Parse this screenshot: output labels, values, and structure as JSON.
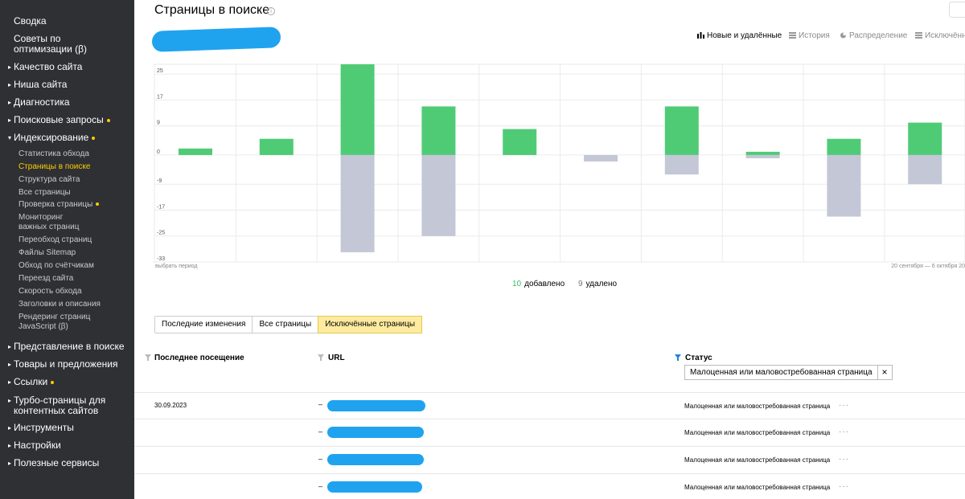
{
  "sidebar": {
    "top_items": [
      {
        "label": "Сводка"
      },
      {
        "label": "Советы по",
        "label2": "оптимизации (β)"
      }
    ],
    "sections": [
      {
        "label": "Качество сайта",
        "dot": false
      },
      {
        "label": "Ниша сайта",
        "dot": false
      },
      {
        "label": "Диагностика",
        "dot": false
      },
      {
        "label": "Поисковые запросы",
        "dot": true
      },
      {
        "label": "Индексирование",
        "dot": true
      }
    ],
    "indexing_items": [
      "Статистика обхода",
      "Страницы в поиске",
      "Структура сайта",
      "Все страницы",
      "Проверка страницы",
      "Мониторинг",
      "важных страниц",
      "Переобход страниц",
      "Файлы Sitemap",
      "Обход по счётчикам",
      "Переезд сайта",
      "Скорость обхода",
      "Заголовки и описания",
      "Рендеринг страниц",
      "JavaScript (β)"
    ],
    "bottom_sections": [
      {
        "label": "Представление в поиске",
        "dot": false
      },
      {
        "label": "Товары и предложения",
        "dot": false
      },
      {
        "label": "Ссылки",
        "dot": true
      },
      {
        "label": "Турбо-страницы для",
        "label2": "контентных сайтов",
        "dot": false
      },
      {
        "label": "Инструменты",
        "dot": false
      },
      {
        "label": "Настройки",
        "dot": false
      },
      {
        "label": "Полезные сервисы",
        "dot": false
      }
    ]
  },
  "header": {
    "title": "Страницы в поиске",
    "info_icon": "i"
  },
  "chart_tabs": [
    {
      "label": "Новые и удалённые",
      "icon": "bars-icon"
    },
    {
      "label": "История",
      "icon": "history-icon"
    },
    {
      "label": "Распределение",
      "icon": "pie-icon"
    },
    {
      "label": "Исключённ",
      "icon": "excluded-icon"
    }
  ],
  "chart_data": {
    "type": "bar",
    "y_ticks": [
      "25",
      "17",
      "9",
      "0",
      "-9",
      "-17",
      "-25",
      "-33"
    ],
    "ylim": [
      -33,
      28
    ],
    "series": [
      {
        "color": "#4fcb76",
        "values": [
          2,
          5,
          28,
          15,
          8,
          0,
          15,
          1,
          5,
          10
        ]
      },
      {
        "color": "#c4c7d6",
        "values": [
          0,
          0,
          -30,
          -25,
          0,
          -2,
          -6,
          -1,
          -19,
          -9
        ]
      }
    ],
    "period_left": "выбрать период",
    "period_right": "20 сентября — 6 октября 20"
  },
  "legend": {
    "added_count": "10",
    "added_label": "добавлено",
    "deleted_count": "9",
    "deleted_label": "удалено"
  },
  "tabs": [
    {
      "label": "Последние изменения",
      "active": false
    },
    {
      "label": "Все страницы",
      "active": false
    },
    {
      "label": "Исключённые страницы",
      "active": true
    }
  ],
  "table": {
    "col_last_visit": "Последнее посещение",
    "col_url": "URL",
    "col_status": "Статус",
    "filter_value": "Малоценная или маловостребованная страница",
    "filter_close": "×",
    "rows": [
      {
        "date": "30.09.2023",
        "dash": "–",
        "status": "Малоценная или маловостребованная страница",
        "more": "···"
      },
      {
        "date": "",
        "dash": "–",
        "status": "Малоценная или маловостребованная страница",
        "more": "···"
      },
      {
        "date": "",
        "dash": "–",
        "status": "Малоценная или маловостребованная страница",
        "more": "···"
      },
      {
        "date": "",
        "dash": "–",
        "status": "Малоценная или маловостребованная страница",
        "more": "···"
      }
    ]
  }
}
